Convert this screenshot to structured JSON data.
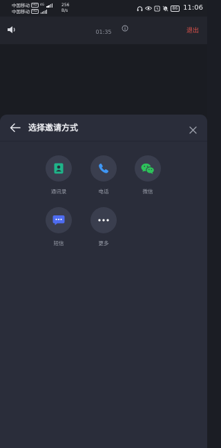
{
  "status_bar": {
    "carrier1": "中国移动",
    "carrier2": "中国移动",
    "hd": "HD",
    "net_type": "4G",
    "net_speed_value": "256",
    "net_speed_unit": "B/s",
    "battery": "86",
    "time": "11:06",
    "icons": [
      "headphones-icon",
      "eye-icon",
      "alarm-icon",
      "mute-icon",
      "battery-icon"
    ]
  },
  "call": {
    "timer": "01:35",
    "exit_label": "退出",
    "speaker_icon": "speaker-icon",
    "info_icon": "info-icon"
  },
  "sheet": {
    "title": "选择邀请方式",
    "options": [
      {
        "label": "通讯录",
        "icon": "contacts-icon",
        "color": "#1fb489"
      },
      {
        "label": "电话",
        "icon": "phone-icon",
        "color": "#3f97f5"
      },
      {
        "label": "微信",
        "icon": "wechat-icon",
        "color": "#2dc35a"
      },
      {
        "label": "短信",
        "icon": "sms-icon",
        "color": "#4e6cf0"
      },
      {
        "label": "更多",
        "icon": "more-icon",
        "color": "#ffffff"
      }
    ]
  },
  "colors": {
    "background": "#1f2128",
    "sheet": "#2a2d3a",
    "icon_circle": "#3a3e4e",
    "exit_red": "#e0524b"
  }
}
